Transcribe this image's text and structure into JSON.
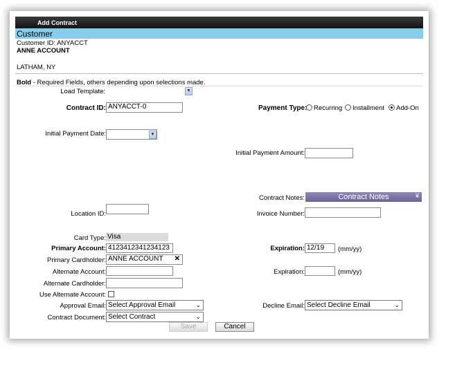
{
  "window": {
    "title": "Add Contract"
  },
  "customer": {
    "section_title": "Customer",
    "id_line": "Customer ID: ANYACCT",
    "name": "ANNE ACCOUNT",
    "location": "LATHAM, NY"
  },
  "note": {
    "bold": "Bold",
    "rest": " - Required Fields, others depending upon selections made."
  },
  "form": {
    "load_template_label": "Load Template:",
    "contract_id_label": "Contract ID:",
    "contract_id_value": "ANYACCT-0",
    "payment_type_label": "Payment Type:",
    "payment_types": [
      "Recurring",
      "Installment",
      "Add-On"
    ],
    "payment_type_selected": "Add-On",
    "initial_payment_date_label": "Initial Payment Date:",
    "initial_payment_amount_label": "Initial Payment Amount:",
    "contract_notes_label": "Contract Notes:",
    "contract_notes_button": "Contract Notes",
    "location_id_label": "Location ID:",
    "invoice_number_label": "Invoice Number:",
    "card_type_label": "Card Type:",
    "card_type_value": "Visa",
    "primary_account_label": "Primary Account:",
    "primary_account_value": "4123412341234123",
    "expiration_label": "Expiration:",
    "expiration_value": "12/19",
    "expiration_hint": "(mm/yy)",
    "primary_cardholder_label": "Primary Cardholder:",
    "primary_cardholder_value": "ANNE ACCOUNT",
    "clear_glyph": "✕",
    "alternate_account_label": "Alternate Account:",
    "alt_expiration_label": "Expiration:",
    "alt_expiration_hint": "(mm/yy)",
    "alternate_cardholder_label": "Alternate Cardholder:",
    "use_alternate_label": "Use Alternate Account:",
    "approval_email_label": "Approval Email:",
    "approval_email_value": "Select Approval Email",
    "decline_email_label": "Decline Email:",
    "decline_email_value": "Select Decline Email",
    "contract_document_label": "Contract Document:",
    "contract_document_value": "Select Contract"
  },
  "buttons": {
    "save": "Save",
    "cancel": "Cancel"
  }
}
